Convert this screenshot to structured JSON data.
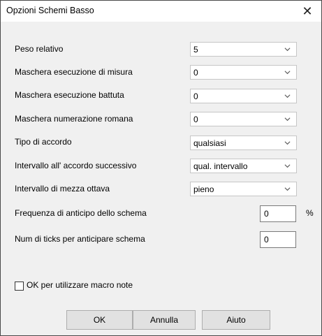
{
  "dialog": {
    "title": "Opzioni Schemi Basso",
    "close_glyph": "✕"
  },
  "fields": [
    {
      "label": "Peso relativo",
      "value": "5"
    },
    {
      "label": "Maschera esecuzione di misura",
      "value": "0"
    },
    {
      "label": "Maschera esecuzione battuta",
      "value": "0"
    },
    {
      "label": "Maschera numerazione romana",
      "value": "0"
    },
    {
      "label": "Tipo di accordo",
      "value": "qualsiasi"
    },
    {
      "label": "Intervallo all' accordo successivo",
      "value": "qual. intervallo"
    },
    {
      "label": "Intervallo di mezza ottava",
      "value": "pieno"
    }
  ],
  "anticipation_frequency": {
    "label": "Frequenza di anticipo dello schema",
    "value": "0",
    "unit": "%"
  },
  "anticipation_ticks": {
    "label": "Num di ticks per anticipare schema",
    "value": "0"
  },
  "macro_notes": {
    "label": "OK per utilizzare macro note",
    "checked": false
  },
  "buttons": {
    "ok": "OK",
    "cancel": "Annulla",
    "help": "Aiuto"
  },
  "icons": {
    "dropdown": "chevron-down-icon",
    "close": "close-icon"
  }
}
